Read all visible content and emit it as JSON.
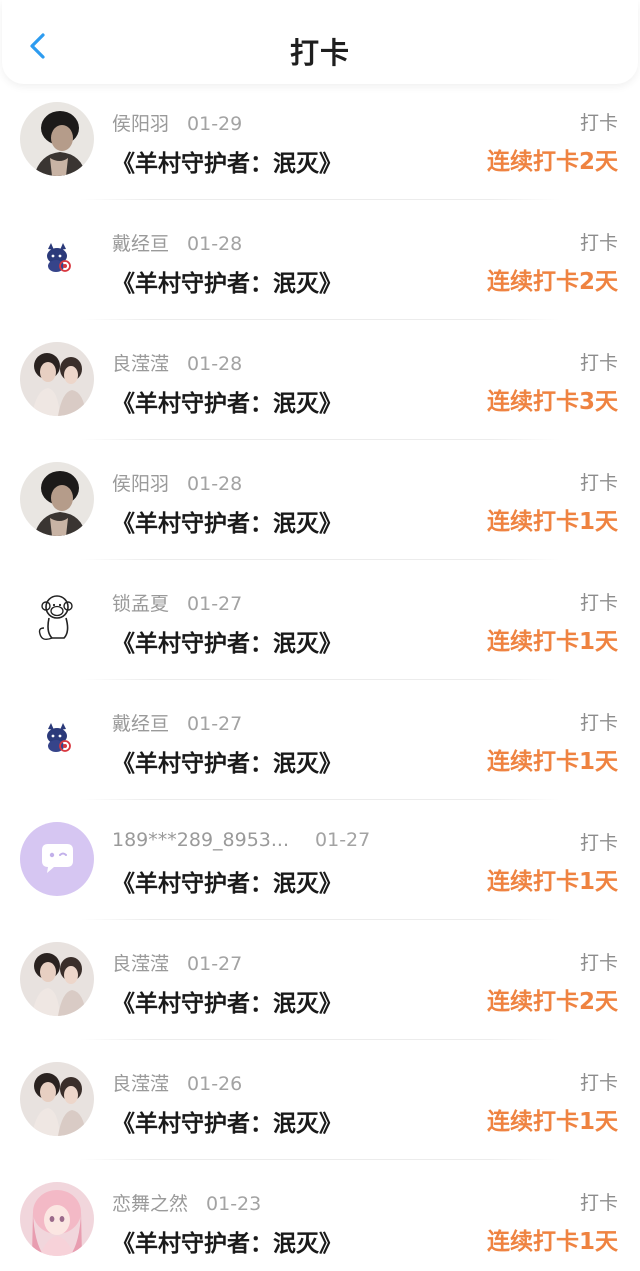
{
  "header": {
    "title": "打卡"
  },
  "items": [
    {
      "user": "侯阳羽",
      "date": "01-29",
      "title": "《羊村守护者：泯灭》",
      "tag": "打卡",
      "streak": "连续打卡2天",
      "avatar": "avatar-photo-man"
    },
    {
      "user": "戴经亘",
      "date": "01-28",
      "title": "《羊村守护者：泯灭》",
      "tag": "打卡",
      "streak": "连续打卡2天",
      "avatar": "avatar-cartoon-cat"
    },
    {
      "user": "良滢滢",
      "date": "01-28",
      "title": "《羊村守护者：泯灭》",
      "tag": "打卡",
      "streak": "连续打卡3天",
      "avatar": "avatar-photo-two-girls"
    },
    {
      "user": "侯阳羽",
      "date": "01-28",
      "title": "《羊村守护者：泯灭》",
      "tag": "打卡",
      "streak": "连续打卡1天",
      "avatar": "avatar-photo-man"
    },
    {
      "user": "锁孟夏",
      "date": "01-27",
      "title": "《羊村守护者：泯灭》",
      "tag": "打卡",
      "streak": "连续打卡1天",
      "avatar": "avatar-monkey-sketch"
    },
    {
      "user": "戴经亘",
      "date": "01-27",
      "title": "《羊村守护者：泯灭》",
      "tag": "打卡",
      "streak": "连续打卡1天",
      "avatar": "avatar-cartoon-cat"
    },
    {
      "user": "189***289_8953...",
      "date": "01-27",
      "title": "《羊村守护者：泯灭》",
      "tag": "打卡",
      "streak": "连续打卡1天",
      "avatar": "avatar-default-chat"
    },
    {
      "user": "良滢滢",
      "date": "01-27",
      "title": "《羊村守护者：泯灭》",
      "tag": "打卡",
      "streak": "连续打卡2天",
      "avatar": "avatar-photo-two-girls"
    },
    {
      "user": "良滢滢",
      "date": "01-26",
      "title": "《羊村守护者：泯灭》",
      "tag": "打卡",
      "streak": "连续打卡1天",
      "avatar": "avatar-photo-two-girls"
    },
    {
      "user": "恋舞之然",
      "date": "01-23",
      "title": "《羊村守护者：泯灭》",
      "tag": "打卡",
      "streak": "连续打卡1天",
      "avatar": "avatar-anime-girl"
    }
  ],
  "colors": {
    "accent": "#ef8341",
    "back_arrow": "#2d9cf0",
    "title_text": "#1a1a1a",
    "meta_text": "#9a9a9a"
  }
}
